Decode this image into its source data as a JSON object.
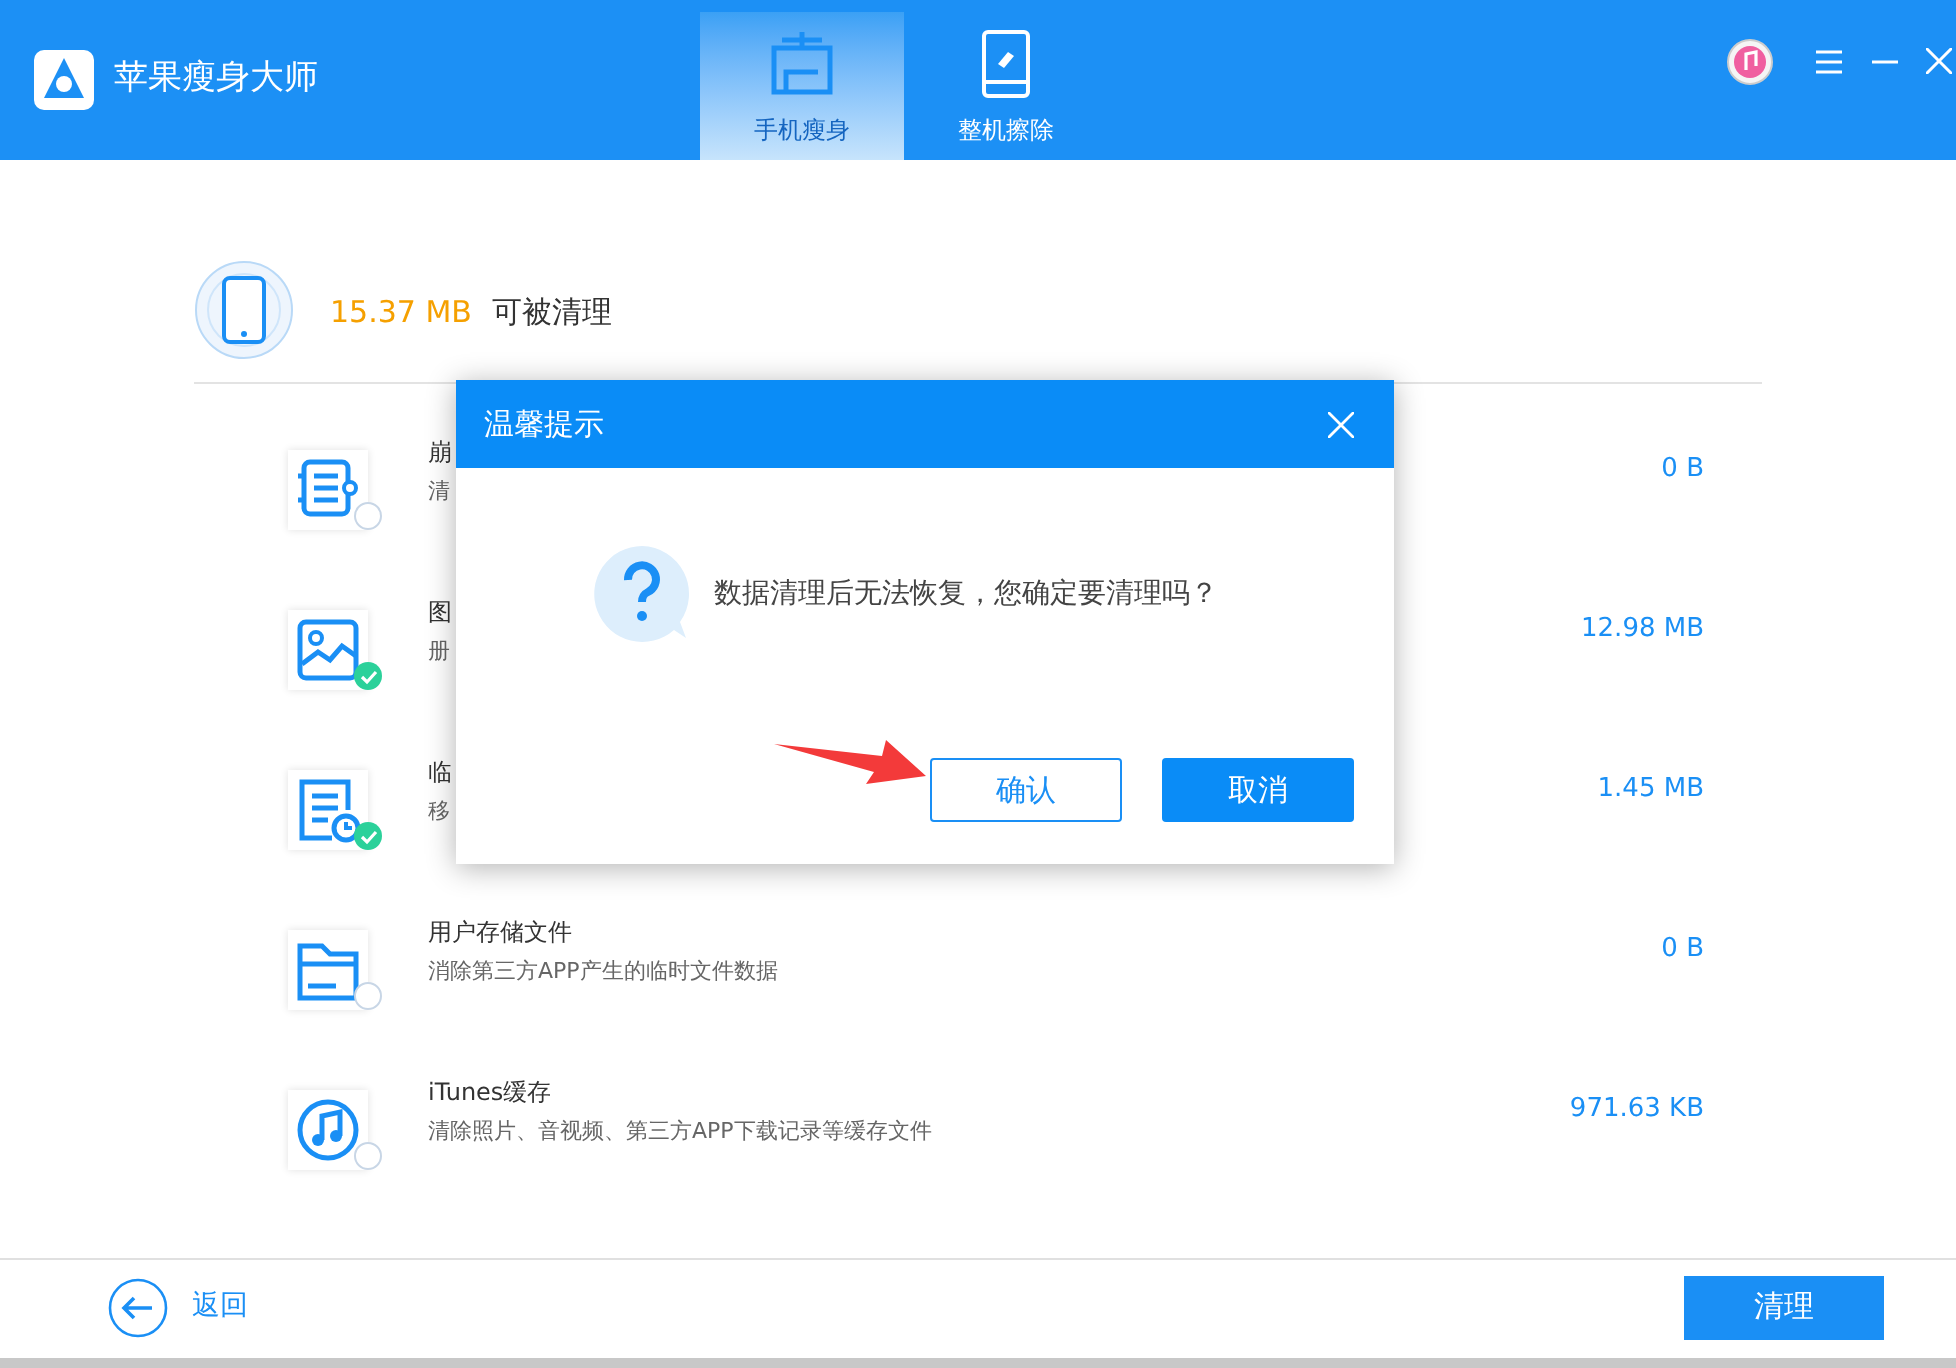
{
  "app": {
    "title": "苹果瘦身大师"
  },
  "tabs": [
    {
      "label": "手机瘦身",
      "selected": true,
      "kind": "slim"
    },
    {
      "label": "整机擦除",
      "selected": false,
      "kind": "erase"
    }
  ],
  "summary": {
    "size": "15.37 MB",
    "label": "可被清理"
  },
  "items": [
    {
      "kind": "log",
      "title": "崩",
      "desc": "清",
      "size": "0 B",
      "checked": false
    },
    {
      "kind": "photo",
      "title": "图",
      "desc": "册",
      "size": "12.98 MB",
      "checked": true
    },
    {
      "kind": "temp",
      "title": "临",
      "desc": "移",
      "size": "1.45 MB",
      "checked": true
    },
    {
      "kind": "folder",
      "title": "用户存储文件",
      "desc": "消除第三方APP产生的临时文件数据",
      "size": "0 B",
      "checked": false
    },
    {
      "kind": "music",
      "title": "iTunes缓存",
      "desc": "清除照片、音视频、第三方APP下载记录等缓存文件",
      "size": "971.63 KB",
      "checked": false
    }
  ],
  "footer": {
    "back": "返回",
    "clean": "清理"
  },
  "dialog": {
    "title": "温馨提示",
    "message": "数据清理后无法恢复，您确定要清理吗？",
    "confirm": "确认",
    "cancel": "取消"
  }
}
